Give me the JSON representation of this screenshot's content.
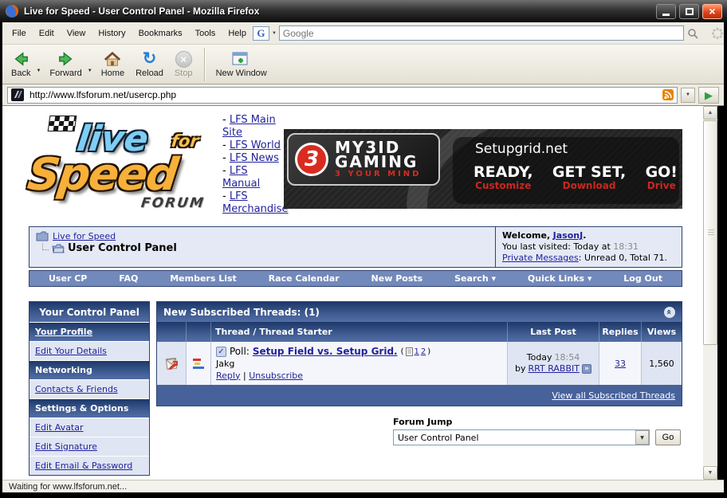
{
  "icons": {
    "caret_down": "▼",
    "reload_arrow": "↻",
    "go_play": "▶",
    "close_x": "×",
    "stop_x": "×",
    "collapse_chevrons": "«",
    "go_last_arrow": "»",
    "checkbox_check": "✓",
    "scroll_up": "▲",
    "scroll_down": "▼"
  },
  "titlebar": {
    "title": "Live for Speed - User Control Panel - Mozilla Firefox"
  },
  "menubar": {
    "items": [
      "File",
      "Edit",
      "View",
      "History",
      "Bookmarks",
      "Tools",
      "Help"
    ],
    "search_engine_letter": "G",
    "search_placeholder": "Google"
  },
  "toolbar": {
    "back": "Back",
    "forward": "Forward",
    "home": "Home",
    "reload": "Reload",
    "stop": "Stop",
    "new_window": "New Window"
  },
  "addressbar": {
    "url": "http://www.lfsforum.net/usercp.php"
  },
  "logo": {
    "live": "live",
    "for": "for",
    "speed": "Speed",
    "forum": "FORUM"
  },
  "sitelinks": {
    "dash": "-",
    "items": [
      "LFS Main Site",
      "LFS World",
      "LFS News",
      "LFS Manual",
      "LFS Merchandise"
    ]
  },
  "banner": {
    "brand_digit": "3",
    "brand_line1": "MY3ID",
    "brand_line2": "GAMING",
    "brand_tagline": "3 YOUR MIND",
    "site": "Setupgrid.net",
    "steps": [
      {
        "main": "READY,",
        "sub": "Customize"
      },
      {
        "main": "GET SET,",
        "sub": "Download"
      },
      {
        "main": "GO!",
        "sub": "Drive"
      }
    ]
  },
  "breadcrumb": {
    "root": "Live for Speed",
    "current": "User Control Panel"
  },
  "welcome": {
    "greeting": "Welcome,",
    "username": "JasonJ",
    "period": ".",
    "visited_prefix": "You last visited: Today at",
    "visited_time": "18:31",
    "pm_link": "Private Messages",
    "pm_rest": ": Unread 0, Total 71."
  },
  "navbar": {
    "items": [
      "User CP",
      "FAQ",
      "Members List",
      "Race Calendar",
      "New Posts",
      "Search",
      "Quick Links",
      "Log Out"
    ]
  },
  "sidebar": {
    "title": "Your Control Panel",
    "profile_category": "Your Profile",
    "link_details": "Edit Your Details",
    "category_networking": "Networking",
    "link_contacts": "Contacts & Friends",
    "category_settings": "Settings & Options",
    "link_avatar": "Edit Avatar",
    "link_signature": "Edit Signature",
    "link_email": "Edit Email & Password"
  },
  "threads": {
    "title": "New Subscribed Threads: (1)",
    "columns": [
      "Thread / Thread Starter",
      "Last Post",
      "Replies",
      "Views"
    ],
    "row": {
      "poll_prefix": "Poll:",
      "title": "Setup Field vs. Setup Grid.",
      "pages_open": "(",
      "page_1": "1",
      "page_2": "2",
      "pages_close": ")",
      "starter": "Jakg",
      "reply": "Reply",
      "link_sep": "|",
      "unsubscribe": "Unsubscribe",
      "last_day": "Today",
      "last_time": "18:54",
      "by": "by",
      "last_user": "RRT RABBIT",
      "replies": "33",
      "views": "1,560"
    },
    "footer_link": "View all Subscribed Threads"
  },
  "forum_jump": {
    "label": "Forum Jump",
    "selected": "User Control Panel",
    "go": "Go"
  },
  "statusbar": {
    "text": "Waiting for www.lfsforum.net..."
  },
  "colors": {
    "close_button": "#e0431c",
    "panel_border": "#2e4372",
    "category_top": "#1d3869",
    "category_bottom": "#526ea5",
    "navbar_blue": "#7289bb",
    "footer_blue": "#47619b",
    "row_light": "#f4f6fb",
    "row_blue": "#dfe5f2",
    "link_navy": "#22229c",
    "banner_red": "#d92b1f"
  }
}
